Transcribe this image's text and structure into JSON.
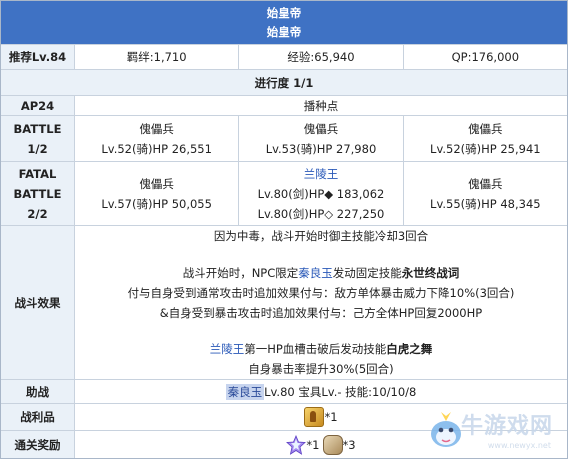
{
  "header": {
    "title": "始皇帝",
    "subtitle": "始皇帝"
  },
  "recommend": {
    "label": "推荐Lv.84",
    "bond": "羁绊:1,710",
    "exp": "经验:65,940",
    "qp": "QP:176,000"
  },
  "progress": {
    "label": "进行度 1/1"
  },
  "ap": {
    "label": "AP24",
    "value": "播种点"
  },
  "battle1": {
    "label_line1": "BATTLE",
    "label_line2": "1/2",
    "enemies": [
      {
        "name": "傀儡兵",
        "stats": "Lv.52(骑)HP 26,551"
      },
      {
        "name": "傀儡兵",
        "stats": "Lv.53(骑)HP 27,980"
      },
      {
        "name": "傀儡兵",
        "stats": "Lv.52(骑)HP 25,941"
      }
    ]
  },
  "battle2": {
    "label_line1": "FATAL",
    "label_line2": "BATTLE",
    "label_line3": "2/2",
    "left": {
      "name": "傀儡兵",
      "stats": "Lv.57(骑)HP 50,055"
    },
    "mid": {
      "name": "兰陵王",
      "stats1": "Lv.80(剑)HP◆ 183,062",
      "stats2": "Lv.80(剑)HP◇ 227,250"
    },
    "right": {
      "name": "傀儡兵",
      "stats": "Lv.55(骑)HP 48,345"
    }
  },
  "effects": {
    "label": "战斗效果",
    "line1": "因为中毒，战斗开始时御主技能冷却3回合",
    "line2_a": "战斗开始时，NPC限定",
    "line2_name": "秦良玉",
    "line2_b": "发动固定技能",
    "line2_skill": "永世终战词",
    "line3": "付与自身受到通常攻击时追加效果付与：敌方单体暴击威力下降10%(3回合)",
    "line4": "&自身受到暴击攻击时追加效果付与：己方全体HP回复2000HP",
    "line5_name": "兰陵王",
    "line5_a": "第一HP血槽击破后发动技能",
    "line5_skill": "白虎之舞",
    "line6": "自身暴击率提升30%(5回合)"
  },
  "support": {
    "label": "助战",
    "servant": "秦良玉",
    "rest": " Lv.80 宝具Lv.- 技能:10/10/8"
  },
  "loot": {
    "label": "战利品",
    "item_icon": "bronze-coin-icon",
    "count": "*1"
  },
  "reward": {
    "label": "通关奖励",
    "item1_icon": "saint-quartz-icon",
    "count1": "*1",
    "item2_icon": "bag-icon",
    "count2": "*3"
  },
  "watermark": {
    "text": "牛游戏网",
    "url": "www.newyx.net"
  },
  "colors": {
    "header_bg": "#3f72c4",
    "label_bg": "#eaf1f8",
    "link": "#2a59b8"
  }
}
